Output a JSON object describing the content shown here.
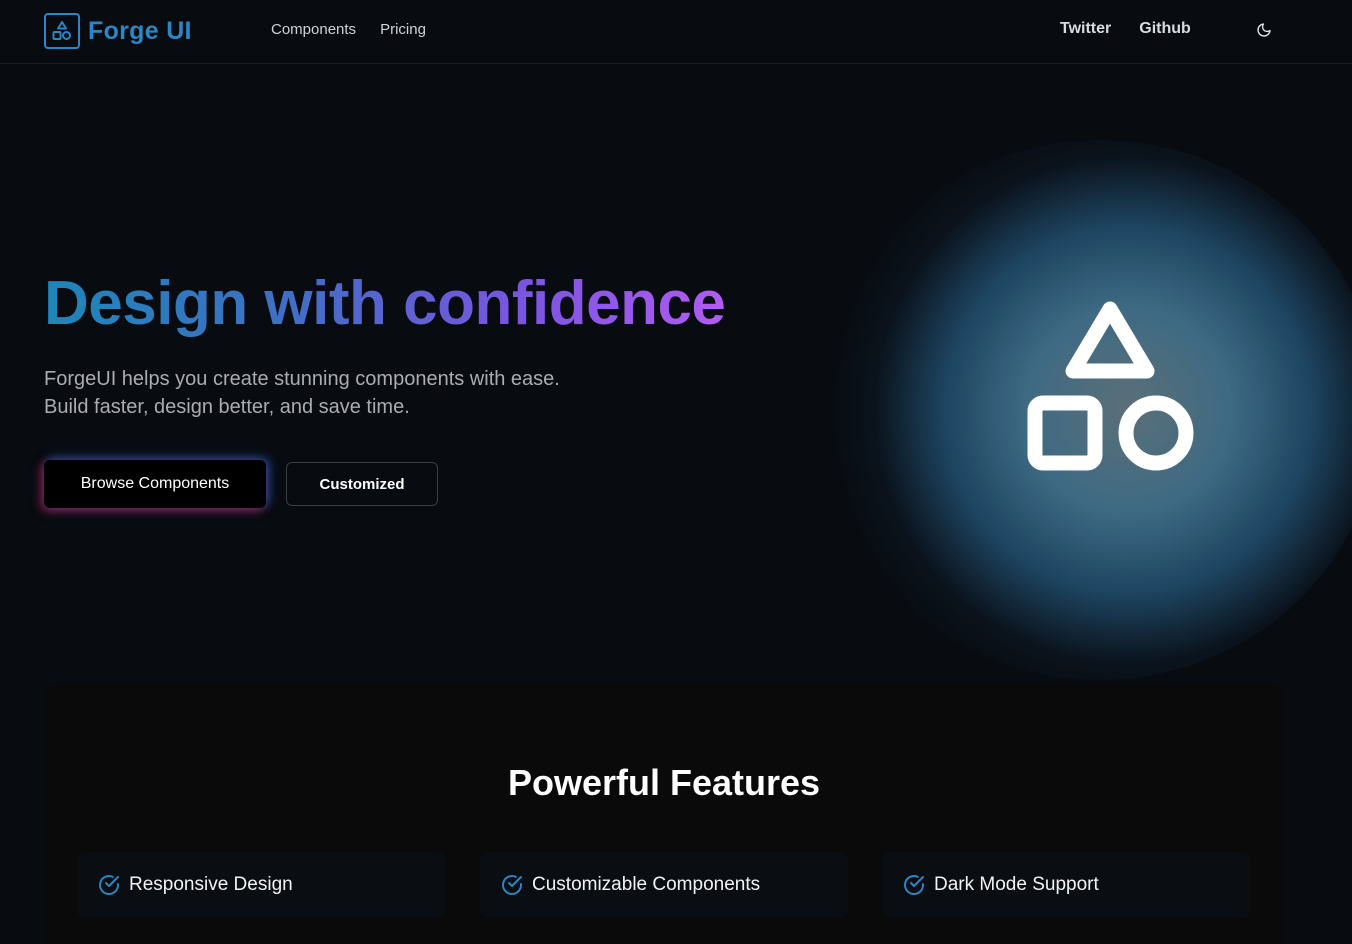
{
  "header": {
    "brand": "Forge UI",
    "nav_left": [
      "Components",
      "Pricing"
    ],
    "nav_right": [
      "Twitter",
      "Github"
    ],
    "theme_icon": "moon-icon"
  },
  "hero": {
    "title": "Design with confidence",
    "subtitle_line1": "ForgeUI helps you create stunning components with ease.",
    "subtitle_line2": "Build faster, design better, and save time.",
    "primary_button": "Browse Components",
    "secondary_button": "Customized",
    "illustration": "shapes-icon"
  },
  "features": {
    "title": "Powerful Features",
    "items": [
      {
        "label": "Responsive Design",
        "icon": "check-circle-icon"
      },
      {
        "label": "Customizable Components",
        "icon": "check-circle-icon"
      },
      {
        "label": "Dark Mode Support",
        "icon": "check-circle-icon"
      }
    ]
  },
  "colors": {
    "background": "#080b10",
    "brand": "#2a86c4",
    "title_gradient": [
      "#1e86b8",
      "#7a55e0",
      "#b15cf0"
    ]
  }
}
